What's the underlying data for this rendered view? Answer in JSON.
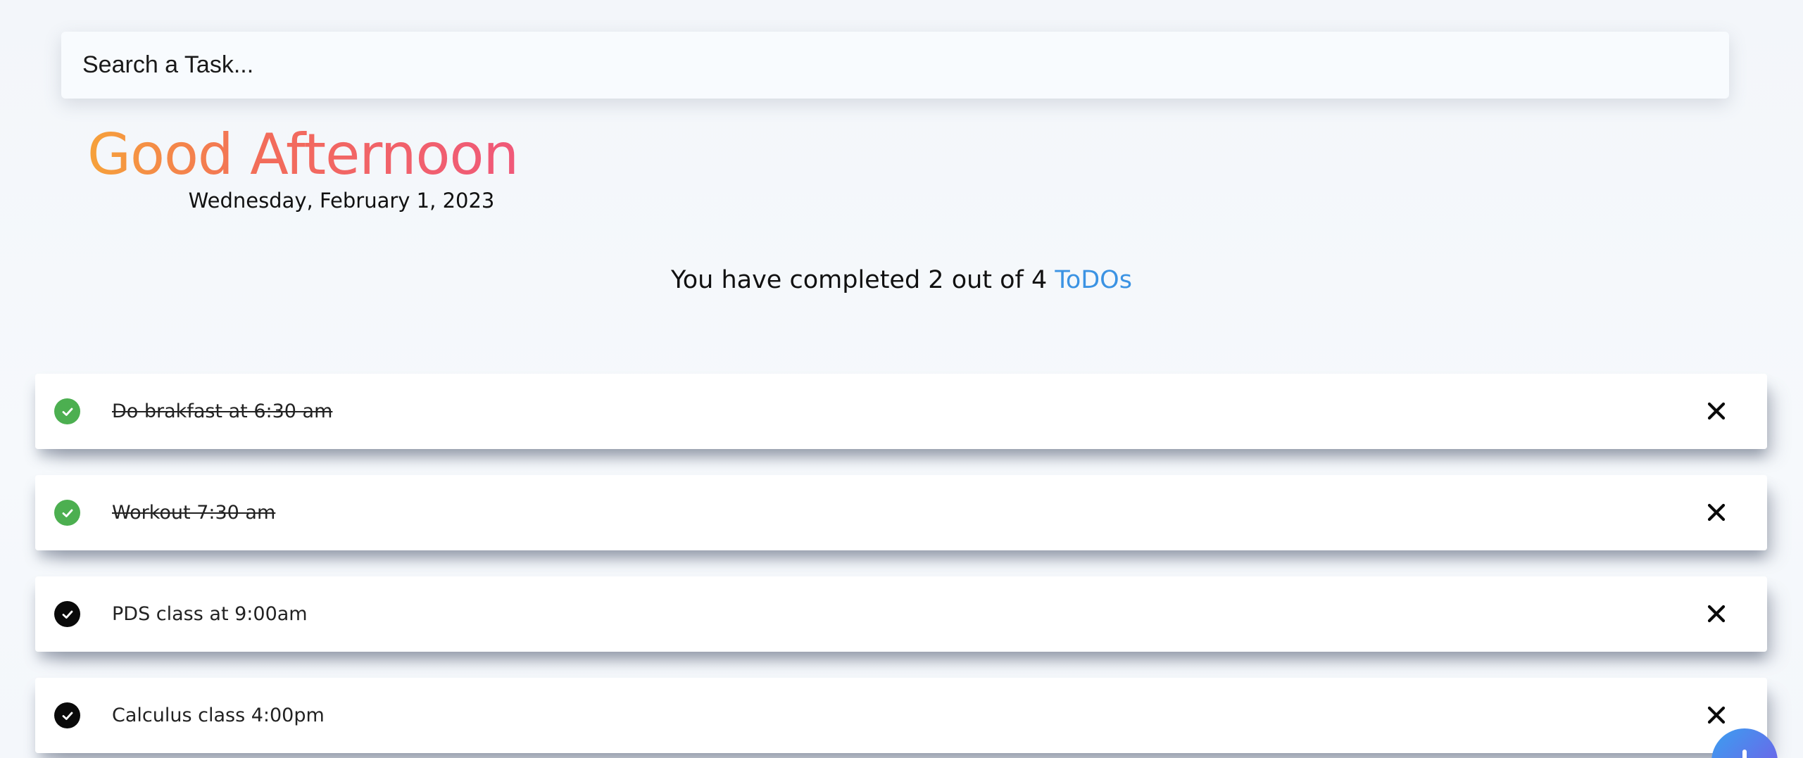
{
  "search": {
    "placeholder": "Search a Task..."
  },
  "header": {
    "greeting": "Good Afternoon!",
    "date": "Wednesday, February 1, 2023"
  },
  "progress": {
    "prefix": "You have completed 2 out of 4 ",
    "accent": "ToDOs",
    "completed": 2,
    "total": 4
  },
  "todos": [
    {
      "text": "Do brakfast at 6:30 am",
      "completed": true
    },
    {
      "text": "Workout 7:30 am",
      "completed": true
    },
    {
      "text": "PDS class at 9:00am",
      "completed": false
    },
    {
      "text": "Calculus class 4:00pm",
      "completed": false
    }
  ],
  "colors": {
    "completed_check": "#4caf50",
    "pending_check": "#0a0a0a",
    "accent": "#3b93e3",
    "greeting_gradient_start": "#f6a23a",
    "greeting_gradient_end": "#f0587a"
  },
  "icons": {
    "check": "check-circle-icon",
    "delete": "close-icon",
    "add": "plus-icon"
  }
}
